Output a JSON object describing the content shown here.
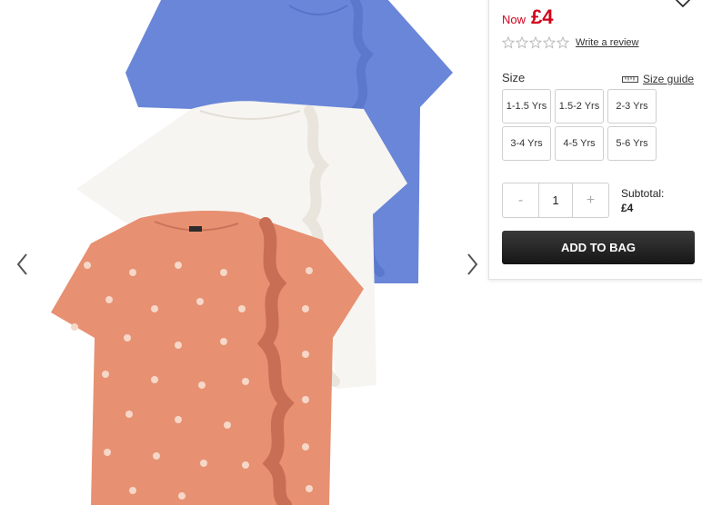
{
  "product": {
    "price_prefix": "Now",
    "price": "£4",
    "write_review": "Write a review"
  },
  "size": {
    "label": "Size",
    "guide": "Size guide",
    "options": [
      "1-1.5 Yrs",
      "1.5-2 Yrs",
      "2-3 Yrs",
      "3-4 Yrs",
      "4-5 Yrs",
      "5-6 Yrs"
    ]
  },
  "quantity": {
    "minus": "-",
    "plus": "+",
    "value": "1"
  },
  "subtotal": {
    "label": "Subtotal:",
    "value": "£4"
  },
  "cart": {
    "add_label": "ADD TO BAG"
  },
  "colors": {
    "price_red": "#d0021b",
    "shirt_blue": "#6a86d8",
    "shirt_white": "#f7f5f1",
    "shirt_coral": "#e79072"
  },
  "icons": [
    "heart-icon",
    "star-icon",
    "ruler-icon",
    "chevron-left-icon",
    "chevron-right-icon"
  ]
}
